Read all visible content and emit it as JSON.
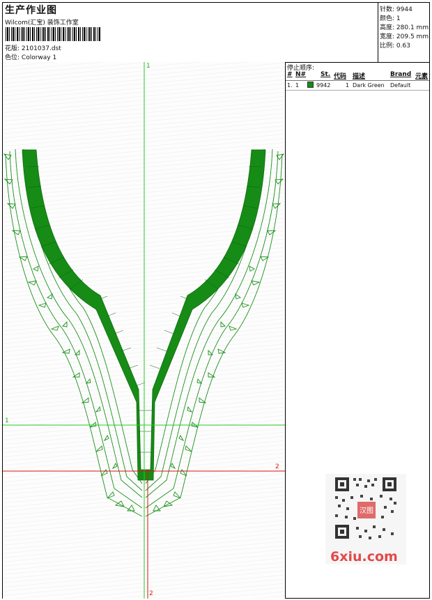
{
  "header": {
    "title": "生产作业图",
    "company": "Wilcom(汇宝) 装饰工作室",
    "pattern_label": "花版:",
    "pattern_value": "2101037.dst",
    "colorway_label": "色位:",
    "colorway_value": "Colorway 1"
  },
  "stats": {
    "stitches_label": "针数:",
    "stitches_value": "9944",
    "colors_label": "颜色:",
    "colors_value": "1",
    "height_label": "高度:",
    "height_value": "280.1 mm",
    "width_label": "宽度:",
    "width_value": "209.5 mm",
    "scale_label": "比例:",
    "scale_value": "0.63"
  },
  "markers": {
    "v1": "1",
    "h1": "1",
    "h2": "2",
    "v2": "2"
  },
  "stop_sequence": {
    "title": "停止顺序:",
    "columns": [
      "#",
      "N#",
      "St.",
      "代码",
      "描述",
      "Brand",
      "元素"
    ],
    "rows": [
      {
        "index": "1.",
        "needle": "1",
        "stitches": "9942",
        "code": "1",
        "description": "Dark Green",
        "brand": "Default",
        "color": "#168c16"
      }
    ]
  },
  "watermark": {
    "text": "6xiu.com",
    "badge": "汉图"
  },
  "colors": {
    "thread": "#168c16",
    "guide_green": "#22cc22",
    "guide_red": "#dd1111",
    "outline": "#1a8f1a"
  }
}
